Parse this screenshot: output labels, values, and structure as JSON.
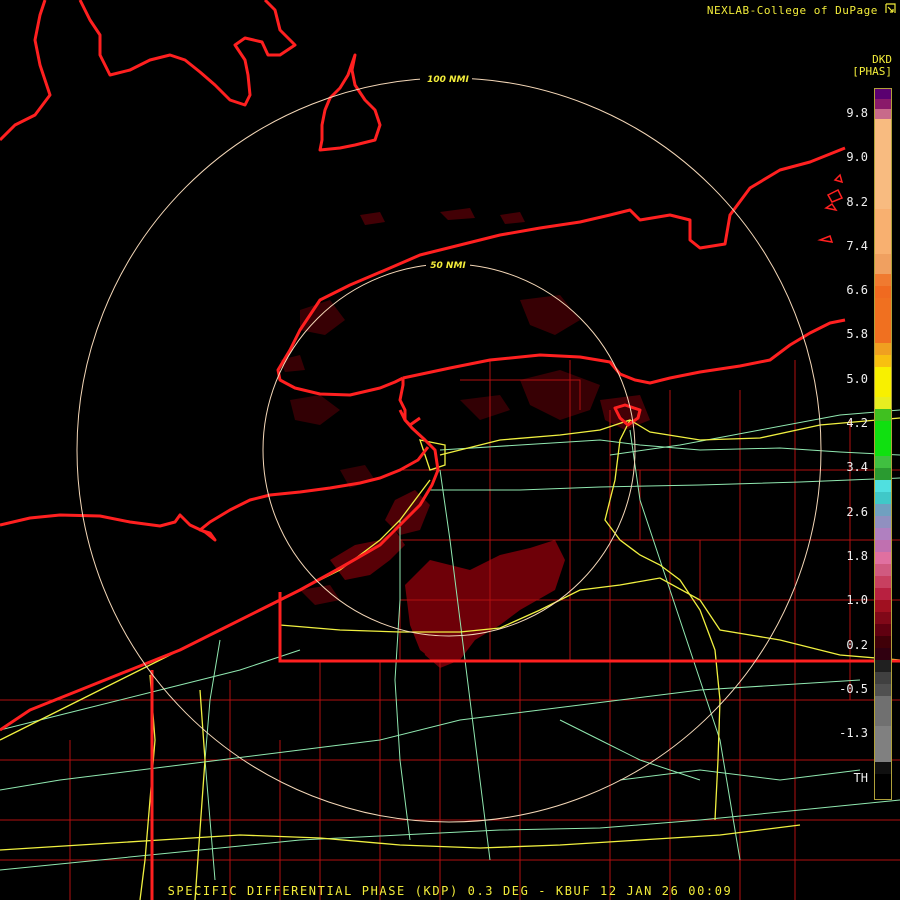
{
  "credit": {
    "text": "NEXLAB-College of DuPage",
    "icon": "nexlab-logo-icon"
  },
  "product": {
    "code": "DKD",
    "units": "[PHAS]"
  },
  "range_rings": [
    {
      "label": "100 NMI"
    },
    {
      "label": "50 NMI"
    }
  ],
  "legend": {
    "labels": [
      "9.8",
      "9.0",
      "8.2",
      "7.4",
      "6.6",
      "5.8",
      "5.0",
      "4.2",
      "3.4",
      "2.6",
      "1.8",
      "1.0",
      "0.2",
      "-0.5",
      "-1.3",
      "TH"
    ]
  },
  "footer": {
    "text": "SPECIFIC DIFFERENTIAL PHASE (KDP) 0.3 DEG - KBUF 12 JAN 26 00:09"
  },
  "colors": {
    "coastline": "#ff2020",
    "county_lines": "#b01010",
    "interstates": "#f0f040",
    "highways": "#90e8b0",
    "range_rings": "#f5d8b8",
    "echo": "#6e0008"
  }
}
